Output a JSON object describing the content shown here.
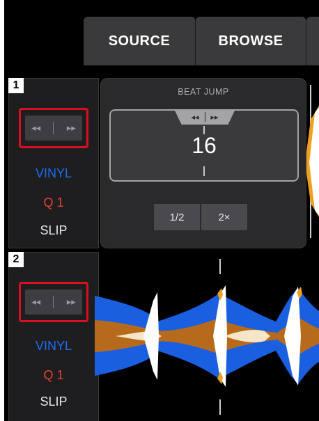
{
  "tabs": {
    "source": "SOURCE",
    "browse": "BROWSE"
  },
  "deck1": {
    "number": "1",
    "jump_back_icon": "◂◂",
    "jump_fwd_icon": "▸▸",
    "vinyl": "VINYL",
    "quantize": "Q 1",
    "slip": "SLIP"
  },
  "deck2": {
    "number": "2",
    "jump_back_icon": "◂◂",
    "jump_fwd_icon": "▸▸",
    "vinyl": "VINYL",
    "quantize": "Q 1",
    "slip": "SLIP"
  },
  "beat_jump": {
    "title": "BEAT JUMP",
    "back_icon": "◂◂",
    "fwd_icon": "▸▸",
    "value": "16",
    "half_label": "1/2",
    "double_label": "2×"
  },
  "colors": {
    "accent_red": "#d8101e",
    "vinyl_blue": "#1a6ff0",
    "quantize_red": "#e8442a",
    "waveform_blue": "#1a5fe0",
    "waveform_orange": "#b86a1c",
    "waveform_white": "#ffffff",
    "waveform_cream": "#f5e6c8"
  }
}
